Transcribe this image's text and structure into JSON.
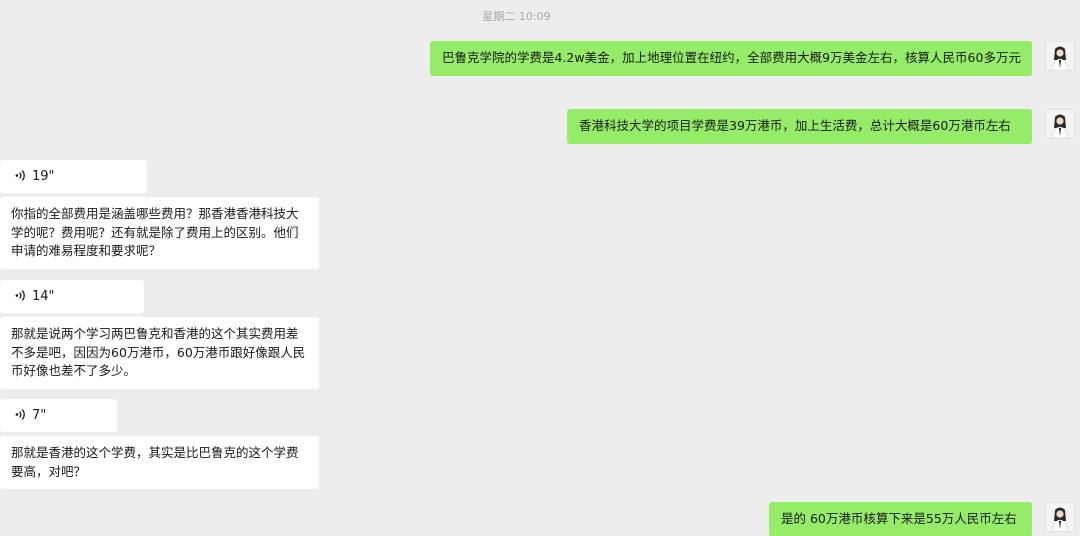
{
  "timestamp": "星期二 10:09",
  "messages": [
    {
      "side": "out",
      "type": "text",
      "text": "巴鲁克学院的学费是4.2w美金，加上地理位置在纽约，全部费用大概9万美金左右，核算人民币60多万元"
    },
    {
      "side": "out",
      "type": "text",
      "text": "香港科技大学的项目学费是39万港币，加上生活费，总计大概是60万港币左右"
    },
    {
      "side": "in",
      "type": "voice",
      "duration": "19\""
    },
    {
      "side": "in",
      "type": "text",
      "text": "你指的全部费用是涵盖哪些费用？那香港香港科技大学的呢？费用呢？还有就是除了费用上的区别。他们申请的难易程度和要求呢？"
    },
    {
      "side": "in",
      "type": "voice",
      "duration": "14\""
    },
    {
      "side": "in",
      "type": "text",
      "text": "那就是说两个学习两巴鲁克和香港的这个其实费用差不多是吧，因因为60万港币，60万港币跟好像跟人民币好像也差不了多少。"
    },
    {
      "side": "in",
      "type": "voice",
      "duration": "7\""
    },
    {
      "side": "in",
      "type": "text",
      "text": "那就是香港的这个学费，其实是比巴鲁克的这个学费要高，对吧？"
    },
    {
      "side": "out",
      "type": "text",
      "text": "是的 60万港币核算下来是55万人民币左右"
    }
  ],
  "icons": {
    "voice": "voice-wave-icon",
    "avatar": "user-avatar-icon"
  },
  "colors": {
    "background": "#ededed",
    "outgoing_bubble": "#95ec69",
    "incoming_bubble": "#ffffff",
    "timestamp_text": "#a8a8a8"
  }
}
